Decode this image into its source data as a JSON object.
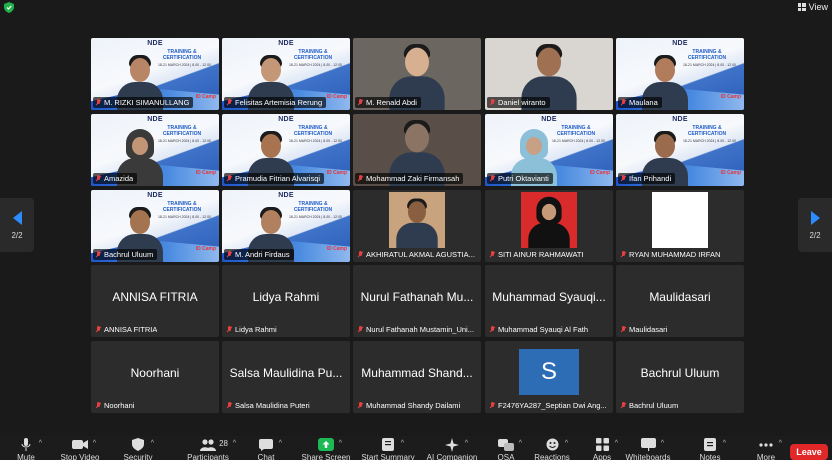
{
  "top": {
    "view_label": "View"
  },
  "nav": {
    "page_left": "2/2",
    "page_right": "2/2"
  },
  "poster": {
    "logo": "NDE",
    "title": "TRAINING & CERTIFICATION",
    "date": "18-21 MARCH 2024 | 8.00 - 12.00",
    "brand": "ID Camp"
  },
  "tiles": [
    {
      "name": "M. RIZKI SIMANULLANG",
      "kind": "poster",
      "skin": "#b88566"
    },
    {
      "name": "Felisitas Artemisia Rerung",
      "kind": "poster",
      "skin": "#c49776"
    },
    {
      "name": "M. Renald Abdi",
      "kind": "cam",
      "bg": "#6b6660",
      "skin": "#d6b091"
    },
    {
      "name": "Daniel wiranto",
      "kind": "cam",
      "bg": "#d9d6d2",
      "skin": "#a07052"
    },
    {
      "name": "Maulana",
      "kind": "poster",
      "skin": "#b07c5b"
    },
    {
      "name": "Amazida",
      "kind": "poster",
      "skin": "#c29577",
      "hijab": "#3a3a3a"
    },
    {
      "name": "Pramudia Fitrian Alvarisqi",
      "kind": "poster",
      "skin": "#a8734f"
    },
    {
      "name": "Mohammad Zaki Firmansah",
      "kind": "cam",
      "bg": "#5a4f48",
      "skin": "#8c7465"
    },
    {
      "name": "Putri Oktavianti",
      "kind": "poster",
      "skin": "#c8a085",
      "hijab": "#8cc0d8"
    },
    {
      "name": "Ifan Prihandi",
      "kind": "poster",
      "skin": "#9a6b4c"
    },
    {
      "name": "Bachrul Uluum",
      "kind": "poster",
      "skin": "#a4734f"
    },
    {
      "name": "M. Andri Firdaus",
      "kind": "poster",
      "skin": "#b0805f"
    },
    {
      "name": "AKHIRATUL AKMAL AGUSTIA...",
      "kind": "photo",
      "photo_bg": "#c9a37d",
      "skin": "#8a5e40"
    },
    {
      "name": "SITI AINUR RAHMAWATI",
      "kind": "photo",
      "photo_bg": "#d92b2b",
      "skin": "#c69a78",
      "hijab": "#111111"
    },
    {
      "name": "RYAN MUHAMMAD IRFAN",
      "kind": "white"
    },
    {
      "name": "ANNISA FITRIA",
      "display": "ANNISA FITRIA",
      "kind": "text"
    },
    {
      "name": "Lidya Rahmi",
      "display": "Lidya Rahmi",
      "kind": "text"
    },
    {
      "name": "Nurul Fathanah Mustamin_Uni...",
      "display": "Nurul Fathanah Mu...",
      "kind": "text"
    },
    {
      "name": "Muhammad Syauqi Al Fath",
      "display": "Muhammad Syauqi...",
      "kind": "text"
    },
    {
      "name": "Maulidasari",
      "display": "Maulidasari",
      "kind": "text"
    },
    {
      "name": "Noorhani",
      "display": "Noorhani",
      "kind": "text"
    },
    {
      "name": "Salsa Maulidina Puteri",
      "display": "Salsa Maulidina Pu...",
      "kind": "text"
    },
    {
      "name": "Muhammad Shandy Dailami",
      "display": "Muhammad Shand...",
      "kind": "text"
    },
    {
      "name": "F2476YA287_Septian Dwi Ang...",
      "kind": "avatar",
      "letter": "S",
      "avatar_color": "#2d6db5"
    },
    {
      "name": "Bachrul Uluum",
      "display": "Bachrul Uluum",
      "kind": "text"
    }
  ],
  "toolbar": {
    "items": [
      {
        "label": "Mute",
        "icon": "microphone-icon"
      },
      {
        "label": "Stop Video",
        "icon": "video-camera-icon"
      },
      {
        "label": "Security",
        "icon": "shield-icon"
      },
      {
        "label": "Participants",
        "icon": "participants-icon",
        "count": "28"
      },
      {
        "label": "Chat",
        "icon": "chat-icon"
      },
      {
        "label": "Share Screen",
        "icon": "share-screen-icon"
      },
      {
        "label": "Start Summary",
        "icon": "summary-icon"
      },
      {
        "label": "AI Companion",
        "icon": "sparkle-icon"
      },
      {
        "label": "QSA",
        "icon": "qa-icon"
      },
      {
        "label": "Reactions",
        "icon": "reactions-icon"
      },
      {
        "label": "Apps",
        "icon": "apps-icon"
      },
      {
        "label": "Whiteboards",
        "icon": "whiteboard-icon"
      },
      {
        "label": "Notes",
        "icon": "notes-icon"
      },
      {
        "label": "More",
        "icon": "more-icon"
      }
    ],
    "leave_label": "Leave"
  },
  "colors": {
    "accent": "#2d8cff",
    "leave": "#e02828",
    "share": "#1db954",
    "muted": "#e54040"
  }
}
